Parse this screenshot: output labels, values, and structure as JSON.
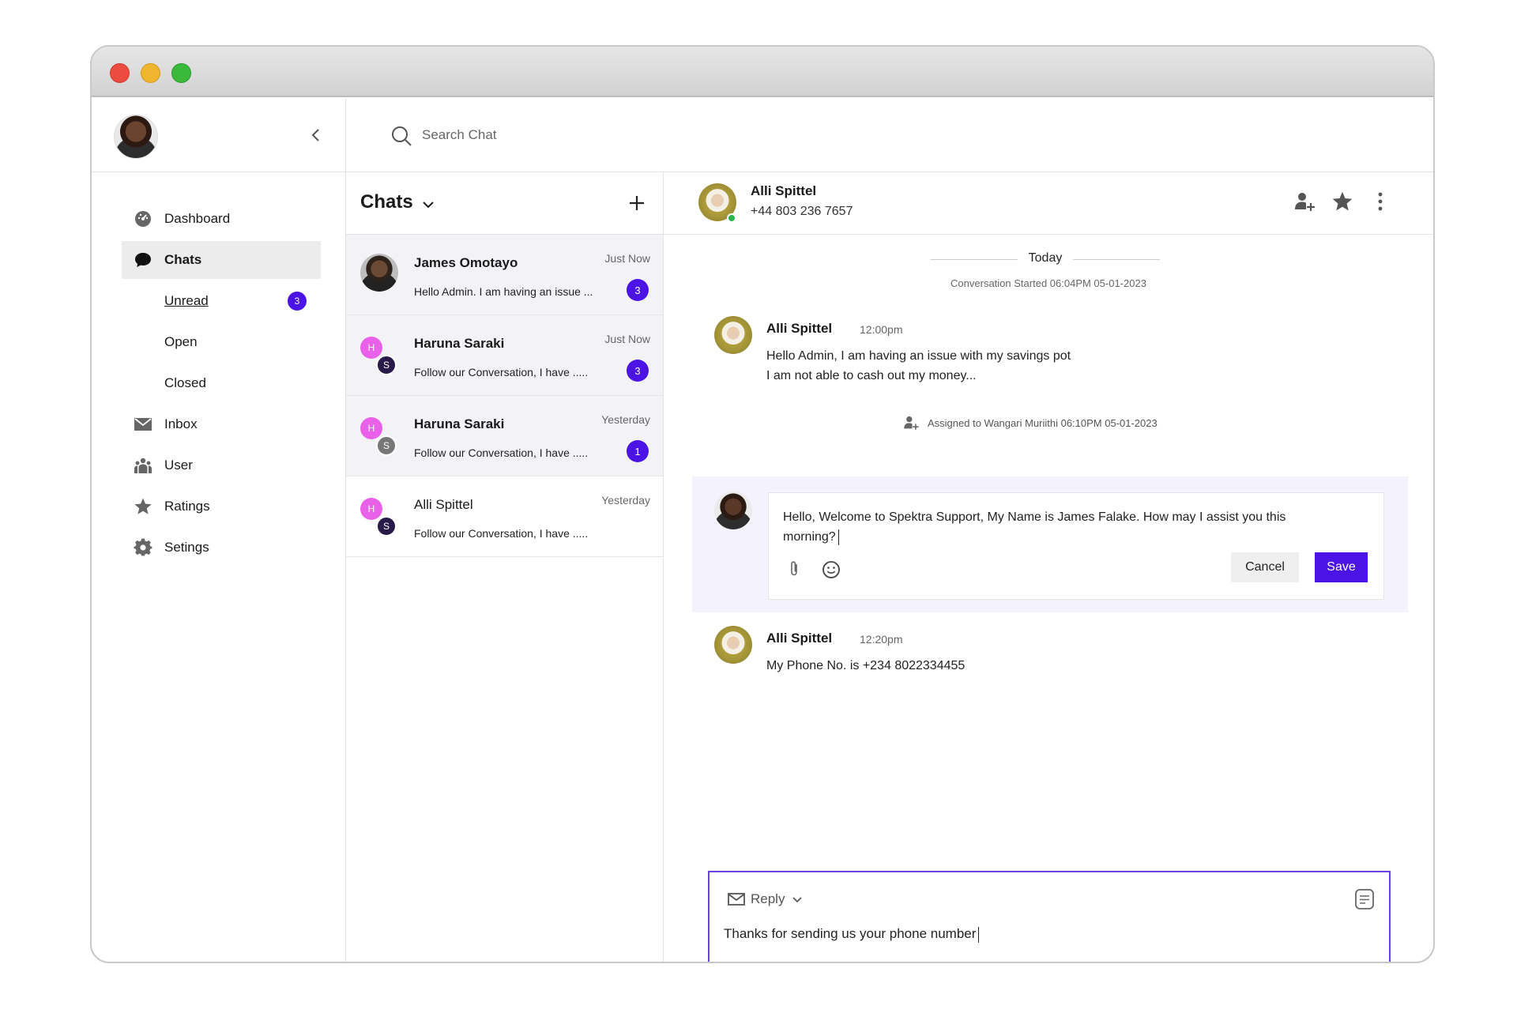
{
  "sidebar": {
    "nav": [
      {
        "label": "Dashboard",
        "icon": "dashboard-icon"
      },
      {
        "label": "Chats",
        "icon": "chat-bubble-icon"
      },
      {
        "label": "Inbox",
        "icon": "envelope-icon"
      },
      {
        "label": "User",
        "icon": "users-icon"
      },
      {
        "label": "Ratings",
        "icon": "star-icon"
      },
      {
        "label": "Setings",
        "icon": "gear-icon"
      }
    ],
    "sub": [
      {
        "label": "Unread",
        "badge": "3"
      },
      {
        "label": "Open"
      },
      {
        "label": "Closed"
      }
    ]
  },
  "search": {
    "placeholder": "Search Chat"
  },
  "chatlist": {
    "title": "Chats",
    "items": [
      {
        "name": "James Omotayo",
        "time": "Just Now",
        "preview": "Hello Admin. I am having an issue ...",
        "badge": "3"
      },
      {
        "name": "Haruna Saraki",
        "time": "Just Now",
        "preview": "Follow our  Conversation, I have .....",
        "badge": "3",
        "initial_a": "H",
        "initial_b": "S"
      },
      {
        "name": "Haruna Saraki",
        "time": "Yesterday",
        "preview": "Follow our  Conversation, I have .....",
        "badge": "1",
        "initial_a": "H",
        "initial_b": "S"
      },
      {
        "name": "Alli Spittel",
        "time": "Yesterday",
        "preview": "Follow our  Conversation, I have .....",
        "initial_a": "H",
        "initial_b": "S"
      }
    ]
  },
  "conversation": {
    "contact_name": "Alli Spittel",
    "contact_phone": "+44 803 236 7657",
    "day_label": "Today",
    "started": "Conversation Started 06:04PM 05-01-2023",
    "messages": [
      {
        "name": "Alli Spittel",
        "time": "12:00pm",
        "lines": [
          "Hello Admin, I am having an issue with my savings pot",
          "I am not able to cash out my money..."
        ]
      },
      {
        "name": "Alli Spittel",
        "time": "12:20pm",
        "lines": [
          "My Phone No. is +234 8022334455"
        ]
      }
    ],
    "assigned": "Assigned to Wangari Muriithi 06:10PM 05-01-2023",
    "draft": {
      "text": "Hello, Welcome to Spektra Support, My Name is James Falake.  How may I assist you this morning?",
      "cancel_label": "Cancel",
      "save_label": "Save"
    },
    "reply": {
      "mode": "Reply",
      "text": "Thanks for sending us your phone number"
    }
  },
  "colors": {
    "accent": "#4b13e6",
    "online": "#2bb44a",
    "initial_h": "#e861e8"
  }
}
